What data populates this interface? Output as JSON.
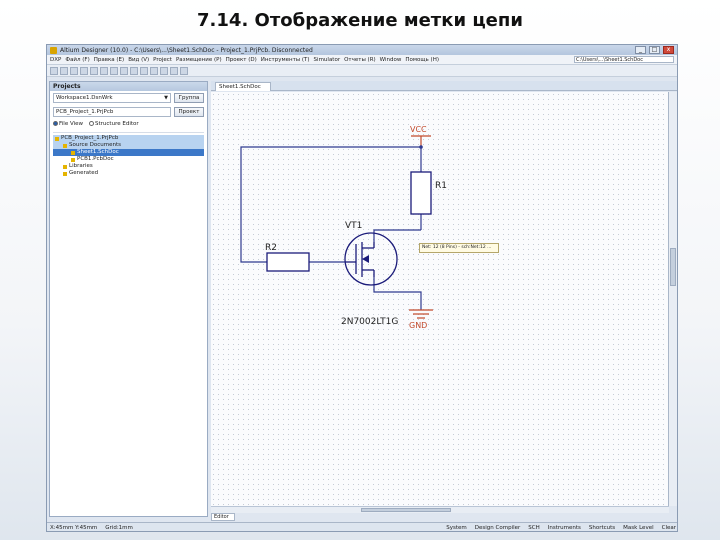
{
  "slide": {
    "title": "7.14. Отображение метки цепи"
  },
  "app": {
    "window_title": "Altium Designer (10.0) - C:\\Users\\...\\Sheet1.SchDoc - Project_1.PrjPcb. Disconnected",
    "menu": [
      "DXP",
      "Файл (F)",
      "Правка (E)",
      "Вид (V)",
      "Project",
      "Размещение (P)",
      "Проект (D)",
      "Инструменты (T)",
      "Simulator",
      "Отчеты (R)",
      "Window",
      "Помощь (H)"
    ],
    "path_box": "C:\\Users\\...\\Sheet1.SchDoc",
    "window_controls": {
      "minimize": "_",
      "maximize": "□",
      "close": "x"
    }
  },
  "projects_panel": {
    "header": "Projects",
    "workspace_combo": "Workspace1.DsnWrk",
    "workspace_button": "Группа",
    "project_combo": "PCB_Project_1.PrjPcb",
    "project_button": "Проект",
    "radio_file_view": "File View",
    "radio_structure": "Structure Editor",
    "tree": [
      {
        "label": "PCB_Project_1.PrjPcb",
        "level": 0,
        "state": "highlight"
      },
      {
        "label": "Source Documents",
        "level": 1,
        "state": "highlight"
      },
      {
        "label": "Sheet1.SchDoc",
        "level": 2,
        "state": "selected"
      },
      {
        "label": "PCB1.PcbDoc",
        "level": 2,
        "state": "normal"
      },
      {
        "label": "Libraries",
        "level": 1,
        "state": "normal"
      },
      {
        "label": "Generated",
        "level": 1,
        "state": "normal"
      }
    ]
  },
  "editor": {
    "tab": "Sheet1.SchDoc",
    "sheet_tab": "Editor",
    "tooltip": "Net: 12 (8 Pins) - sch:Net:12 ..."
  },
  "schematic": {
    "vcc_label": "VCC",
    "gnd_label": "GND",
    "r1_label": "R1",
    "r2_label": "R2",
    "vt_label": "VT1",
    "vt_part": "2N7002LT1G"
  },
  "statusbar": {
    "coords": "X:45mm Y:45mm",
    "grid": "Grid:1mm",
    "items": [
      "System",
      "Design Compiler",
      "SCH",
      "Instruments",
      "Shortcuts",
      "Mask Level",
      "Clear"
    ]
  },
  "colors": {
    "wire": "#2f3a8f",
    "power": "#c24a2c",
    "component": "#1b1b7a",
    "selection": "#3c78c8"
  }
}
